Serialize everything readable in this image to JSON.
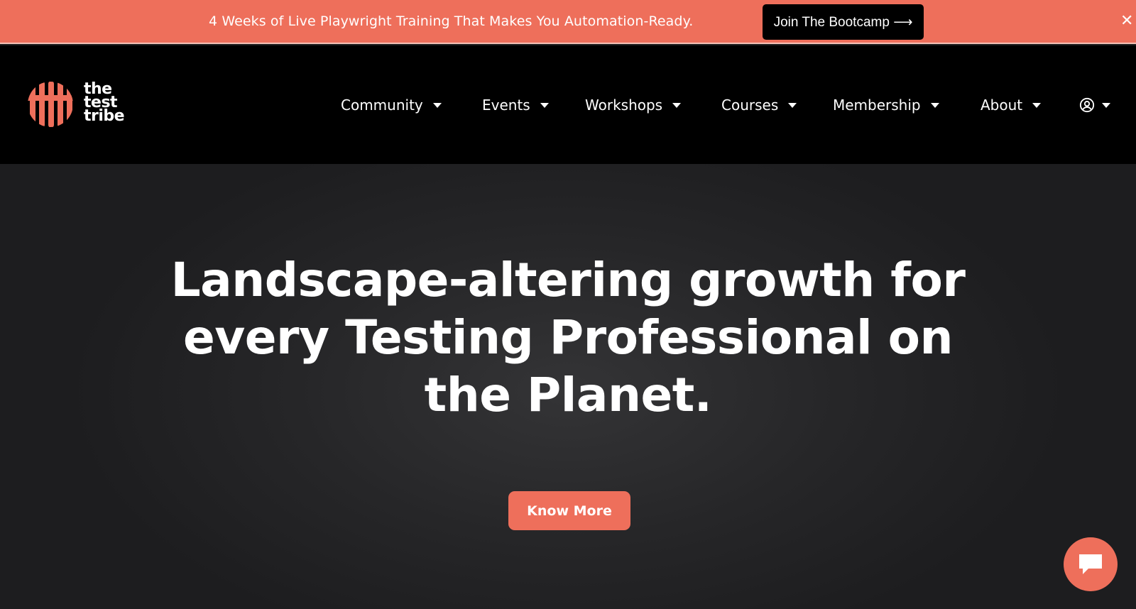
{
  "announcement": {
    "text": "4 Weeks of Live Playwright Training That Makes You Automation-Ready.",
    "button_label": "Join The Bootcamp ⟶",
    "close_glyph": "✕",
    "background_color": "#ee6f5b"
  },
  "header": {
    "logo": {
      "line1": "the",
      "line2": "test",
      "line3": "tribe",
      "icon": "striped-circle-logo",
      "color": "#ee6f5b"
    },
    "nav": [
      {
        "label": "Community"
      },
      {
        "label": "Events"
      },
      {
        "label": "Workshops"
      },
      {
        "label": "Courses"
      },
      {
        "label": "Membership"
      },
      {
        "label": "About"
      }
    ],
    "account_icon": "user-circle-icon"
  },
  "hero": {
    "title": "Landscape-altering growth for every Testing Professional on the Planet.",
    "cta_label": "Know More",
    "accent_color": "#ee6f5b"
  },
  "chat_widget": {
    "icon": "chat-bubble-icon"
  }
}
